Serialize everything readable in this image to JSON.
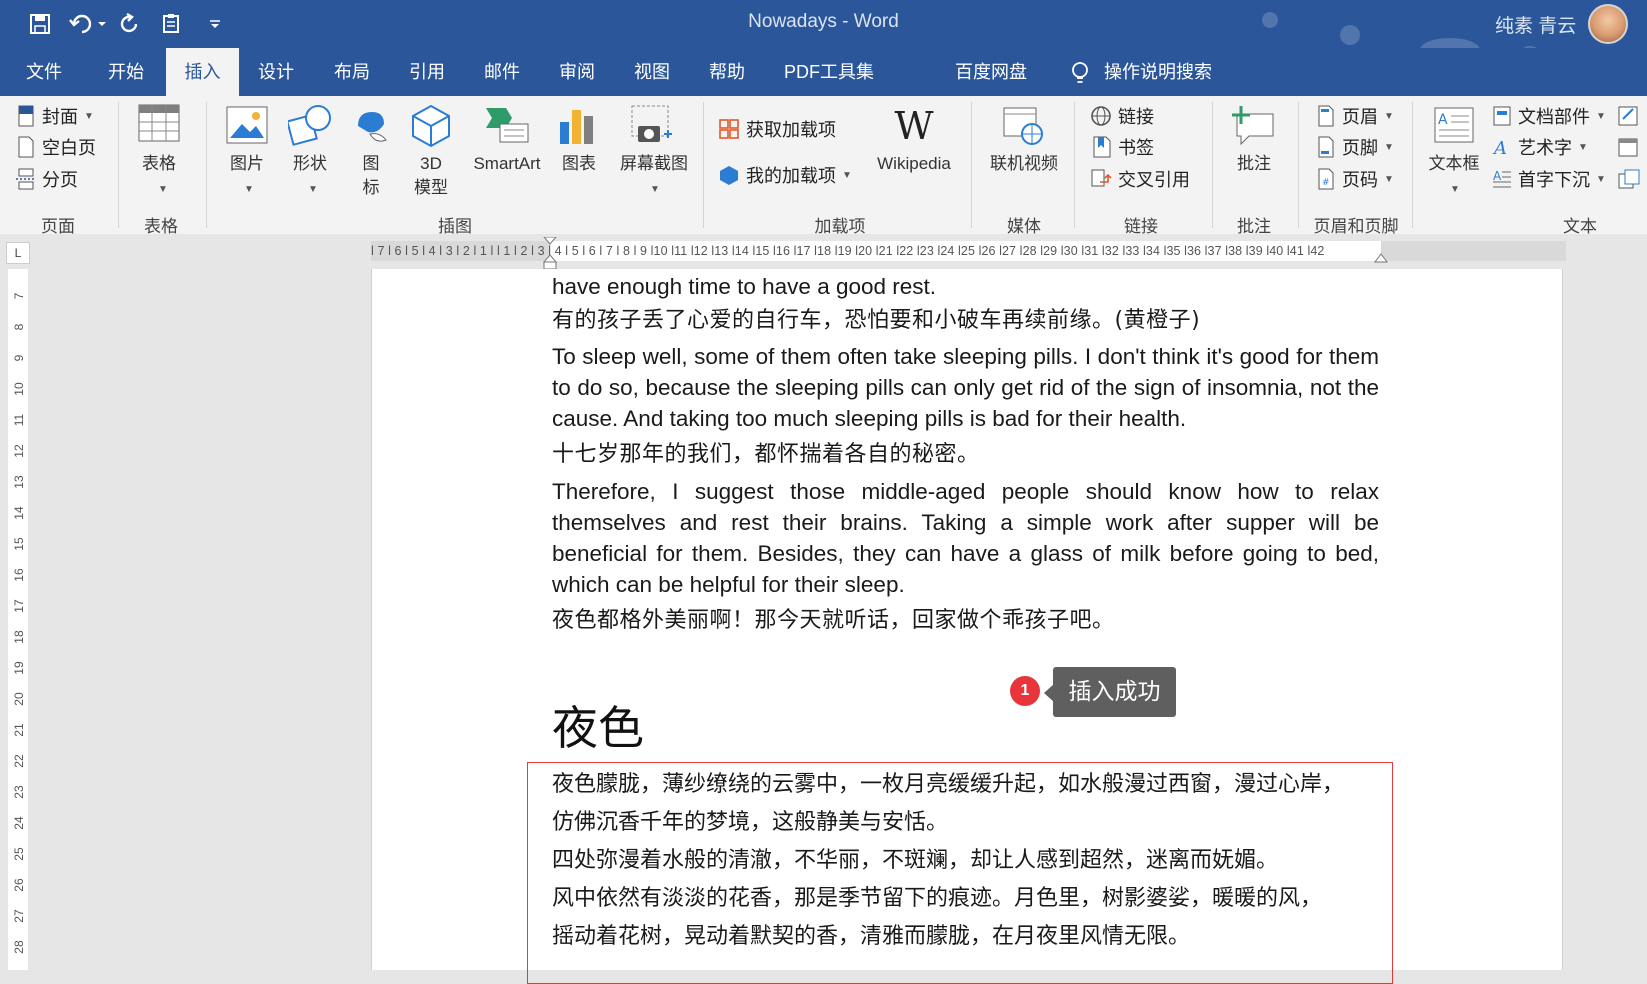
{
  "titlebar": {
    "doc_title": "Nowadays  -  Word",
    "user_name": "纯素 青云"
  },
  "menu": {
    "tabs": [
      "文件",
      "开始",
      "插入",
      "设计",
      "布局",
      "引用",
      "邮件",
      "审阅",
      "视图",
      "帮助",
      "PDF工具集",
      "百度网盘",
      "操作说明搜索"
    ],
    "active": "插入"
  },
  "ribbon": {
    "page_group": {
      "cover": "封面",
      "blank": "空白页",
      "break": "分页",
      "label": "页面"
    },
    "table_group": {
      "table": "表格",
      "label": "表格"
    },
    "illus_group": {
      "picture": "图片",
      "shapes": "形状",
      "icons_l1": "图",
      "icons_l2": "标",
      "model_l1": "3D",
      "model_l2": "模型",
      "smartart": "SmartArt",
      "chart": "图表",
      "screenshot": "屏幕截图",
      "label": "插图"
    },
    "addin_group": {
      "get": "获取加载项",
      "mine": "我的加载项",
      "wiki": "Wikipedia",
      "label": "加载项"
    },
    "media_group": {
      "video": "联机视频",
      "label": "媒体"
    },
    "links_group": {
      "link": "链接",
      "bookmark": "书签",
      "xref": "交叉引用",
      "label": "链接"
    },
    "comment_group": {
      "comment": "批注",
      "label": "批注"
    },
    "hf_group": {
      "header": "页眉",
      "footer": "页脚",
      "pagenum": "页码",
      "label": "页眉和页脚"
    },
    "text_group": {
      "textbox": "文本框",
      "parts": "文档部件",
      "wordart": "艺术字",
      "dropcap": "首字下沉",
      "label": "文本"
    }
  },
  "ruler": {
    "text": "l 7 l 6 l 5 l 4 l 3 l 2 l 1 l     l 1 l 2 l 3 l 4 l 5 l 6 l 7 l 8 l 9 l10 l11 l12 l13 l14 l15 l16 l17 l18 l19 l20 l21 l22 l23 l24 l25 l26 l27 l28 l29 l30 l31 l32 l33 l34 l35 l36 l37 l38 l39 l40 l41 l42",
    "corner": "L",
    "vertical": [
      "7",
      "8",
      "9",
      "10",
      "11",
      "12",
      "13",
      "14",
      "15",
      "16",
      "17",
      "18",
      "19",
      "20",
      "21",
      "22",
      "23",
      "24",
      "25",
      "26",
      "27",
      "28"
    ]
  },
  "document": {
    "p1": "have enough time to have a good rest.",
    "p2": "有的孩子丢了心爱的自行车，恐怕要和小破车再续前缘。(黄橙子)",
    "p3": "To sleep well, some of them often take sleeping pills. I don't think it's good for them to do so, because the sleeping pills can only get rid of the sign of insomnia, not the cause. And taking too much sleeping pills is bad for their health.",
    "p4": "十七岁那年的我们，都怀揣着各自的秘密。",
    "p5": "Therefore, I suggest those middle-aged people should know how to relax themselves and rest their brains. Taking a simple work after supper will be beneficial for them. Besides, they can have a glass of milk before going to bed, which can be helpful for their sleep.",
    "p6": "夜色都格外美丽啊！那今天就听话，回家做个乖孩子吧。",
    "heading": "夜色",
    "inserted": [
      "夜色朦胧，薄纱缭绕的云雾中，一枚月亮缓缓升起，如水般漫过西窗，漫过心岸，",
      "仿佛沉香千年的梦境，这般静美与安恬。",
      "四处弥漫着水般的清澈，不华丽，不斑斓，却让人感到超然，迷离而妩媚。",
      "风中依然有淡淡的花香，那是季节留下的痕迹。月色里，树影婆娑，暖暖的风，",
      "摇动着花树，晃动着默契的香，清雅而朦胧，在月夜里风情无限。"
    ]
  },
  "callout": {
    "number": "1",
    "text": "插入成功"
  },
  "colors": {
    "brand": "#2b579a",
    "highlight_box": "#e23a3a",
    "callout_bg": "#5f5f5f",
    "badge": "#e8343a"
  }
}
